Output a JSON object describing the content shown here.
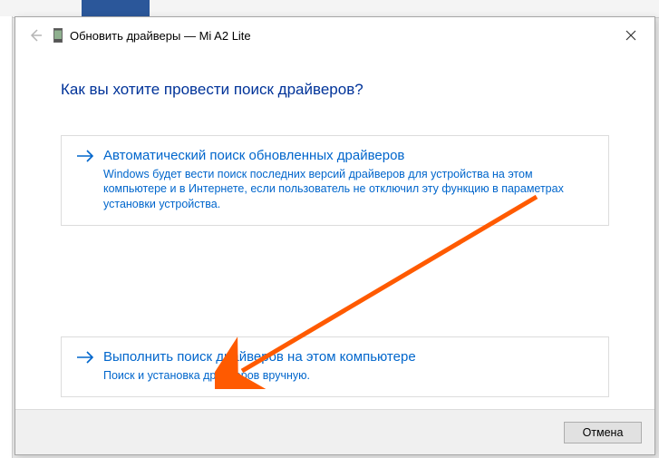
{
  "titlebar": {
    "title": "Обновить драйверы — Mi A2 Lite"
  },
  "heading": "Как вы хотите провести поиск драйверов?",
  "options": {
    "auto": {
      "title": "Автоматический поиск обновленных драйверов",
      "desc": "Windows будет вести поиск последних версий драйверов для устройства на этом компьютере и в Интернете, если пользователь не отключил эту функцию в параметрах установки устройства."
    },
    "manual": {
      "title": "Выполнить поиск драйверов на этом компьютере",
      "desc": "Поиск и установка драйверов вручную."
    }
  },
  "footer": {
    "cancel": "Отмена"
  }
}
